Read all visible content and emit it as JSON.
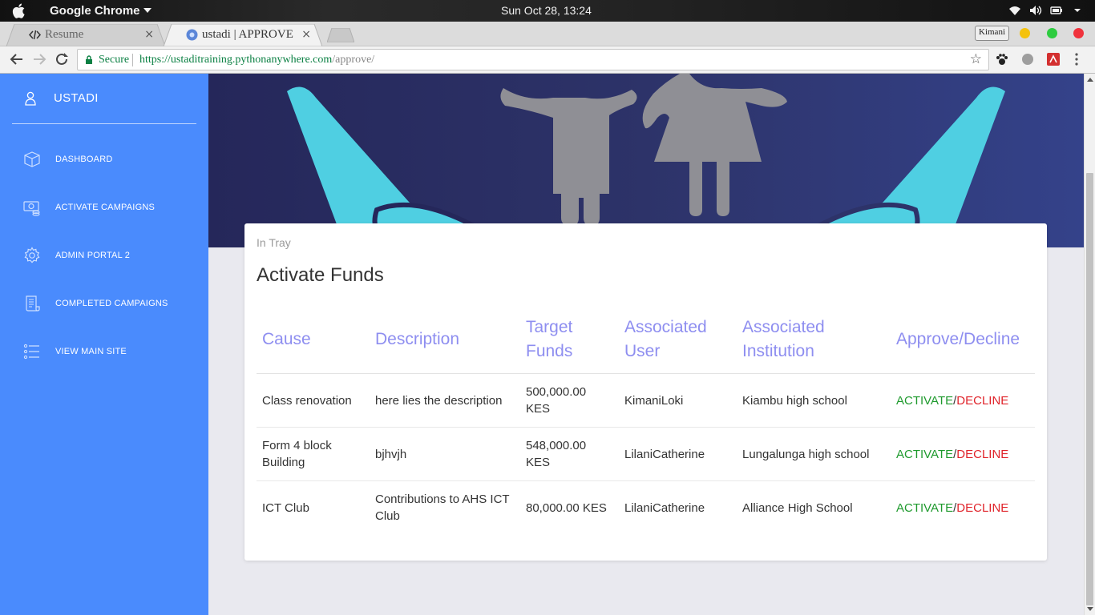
{
  "os": {
    "app_name": "Google Chrome",
    "clock": "Sun Oct 28, 13:24"
  },
  "browser": {
    "tabs": [
      {
        "title": "Resume",
        "close": "×"
      },
      {
        "title": "ustadi | APPROVE",
        "close": "×"
      }
    ],
    "profile_name": "Kimani",
    "secure_label": "Secure",
    "url_host": "https://ustaditraining.pythonanywhere.com",
    "url_path": "/approve/"
  },
  "sidebar": {
    "brand": "USTADI",
    "items": [
      {
        "label": "DASHBOARD",
        "icon": "cube-icon"
      },
      {
        "label": "ACTIVATE CAMPAIGNS",
        "icon": "money-icon"
      },
      {
        "label": "ADMIN PORTAL 2",
        "icon": "gear-icon"
      },
      {
        "label": "COMPLETED CAMPAIGNS",
        "icon": "receipt-icon"
      },
      {
        "label": "VIEW MAIN SITE",
        "icon": "list-icon"
      }
    ]
  },
  "card": {
    "category": "In Tray",
    "title": "Activate Funds",
    "headers": [
      "Cause",
      "Description",
      "Target Funds",
      "Associated User",
      "Associated Institution",
      "Approve/Decline"
    ],
    "rows": [
      {
        "cause": "Class renovation",
        "description": "here lies the description",
        "target": "500,000.00 KES",
        "user": "KimaniLoki",
        "institution": "Kiambu high school",
        "activate": "ACTIVATE",
        "slash": "/",
        "decline": "DECLINE"
      },
      {
        "cause": "Form 4 block Building",
        "description": "bjhvjh",
        "target": "548,000.00 KES",
        "user": "LilaniCatherine",
        "institution": "Lungalunga high school",
        "activate": "ACTIVATE",
        "slash": "/",
        "decline": "DECLINE"
      },
      {
        "cause": "ICT Club",
        "description": "Contributions to AHS ICT Club",
        "target": "80,000.00 KES",
        "user": "LilaniCatherine",
        "institution": "Alliance High School",
        "activate": "ACTIVATE",
        "slash": "/",
        "decline": "DECLINE"
      }
    ]
  },
  "colors": {
    "sidebar_bg": "#4a8bfd",
    "header_text": "#8e8ef0",
    "activate": "#1f9a2e",
    "decline": "#e0232a"
  }
}
